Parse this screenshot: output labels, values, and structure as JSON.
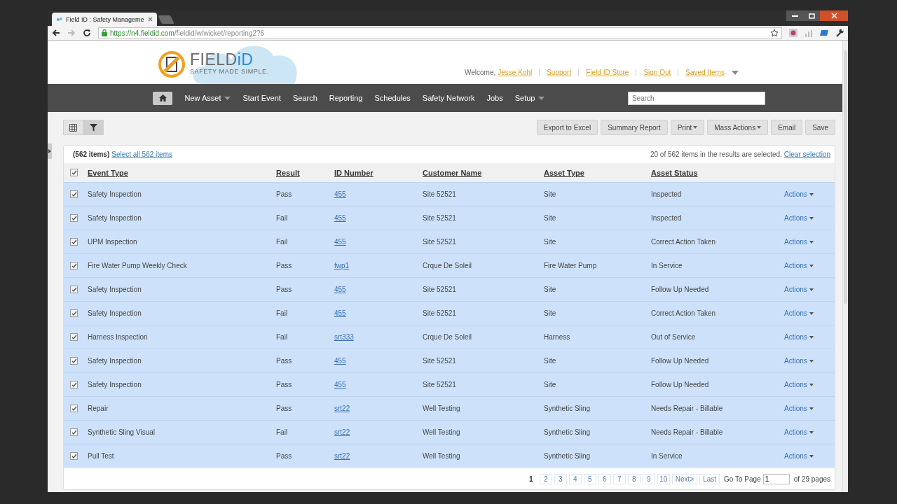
{
  "browser": {
    "tab_title": "Field ID : Safety Manageme",
    "url_host": "https://n4.fieldid.com",
    "url_path": "/fieldid/w/wicket/reporting2?6"
  },
  "logo": {
    "word": "FIELD",
    "accent": "iD",
    "tagline": "SAFETY MADE SIMPLE."
  },
  "user_links": {
    "welcome": "Welcome,",
    "links": [
      "Jesse Kohl",
      "Support",
      "Field ID Store",
      "Sign Out",
      "Saved Items"
    ]
  },
  "nav": {
    "items": [
      {
        "label": "New Asset",
        "has_menu": true
      },
      {
        "label": "Start Event",
        "has_menu": false
      },
      {
        "label": "Search",
        "has_menu": false
      },
      {
        "label": "Reporting",
        "has_menu": false
      },
      {
        "label": "Schedules",
        "has_menu": false
      },
      {
        "label": "Safety Network",
        "has_menu": false
      },
      {
        "label": "Jobs",
        "has_menu": false
      },
      {
        "label": "Setup",
        "has_menu": true
      }
    ],
    "search_placeholder": "Search"
  },
  "view_toggle": [
    {
      "kind": "grid",
      "selected": false
    },
    {
      "kind": "filter",
      "selected": true
    }
  ],
  "toolbar_buttons": [
    {
      "label": "Export to Excel",
      "has_menu": false
    },
    {
      "label": "Summary Report",
      "has_menu": false
    },
    {
      "label": "Print",
      "has_menu": true
    },
    {
      "label": "Mass Actions",
      "has_menu": true
    },
    {
      "label": "Email",
      "has_menu": false
    },
    {
      "label": "Save",
      "has_menu": false
    }
  ],
  "results": {
    "count": "(562 items)",
    "select_all": "Select all 562 items",
    "selection_note": "20 of 562 items in the results are selected.",
    "clear": "Clear selection"
  },
  "table": {
    "all_checked": true,
    "columns": [
      "Event Type",
      "Result",
      "ID Number",
      "Customer Name",
      "Asset Type",
      "Asset Status"
    ],
    "rows": [
      {
        "selected": true,
        "event_type": "Safety Inspection",
        "result": "Pass",
        "id_number": "455",
        "customer": "Site 52521",
        "asset_type": "Site",
        "status": "Inspected",
        "action": "Actions"
      },
      {
        "selected": true,
        "event_type": "Safety Inspection",
        "result": "Fail",
        "id_number": "455",
        "customer": "Site 52521",
        "asset_type": "Site",
        "status": "Inspected",
        "action": "Actions"
      },
      {
        "selected": true,
        "event_type": "UPM Inspection",
        "result": "Fail",
        "id_number": "455",
        "customer": "Site 52521",
        "asset_type": "Site",
        "status": "Correct Action Taken",
        "action": "Actions"
      },
      {
        "selected": true,
        "event_type": "Fire Water Pump Weekly Check",
        "result": "Pass",
        "id_number": "fwp1",
        "customer": "Crque De Soleil",
        "asset_type": "Fire Water Pump",
        "status": "In Service",
        "action": "Actions"
      },
      {
        "selected": true,
        "event_type": "Safety Inspection",
        "result": "Pass",
        "id_number": "455",
        "customer": "Site 52521",
        "asset_type": "Site",
        "status": "Follow Up Needed",
        "action": "Actions"
      },
      {
        "selected": true,
        "event_type": "Safety Inspection",
        "result": "Fail",
        "id_number": "455",
        "customer": "Site 52521",
        "asset_type": "Site",
        "status": "Correct Action Taken",
        "action": "Actions"
      },
      {
        "selected": true,
        "event_type": "Harness Inspection",
        "result": "Fail",
        "id_number": "srt333",
        "customer": "Crque De Soleil",
        "asset_type": "Harness",
        "status": "Out of Service",
        "action": "Actions"
      },
      {
        "selected": true,
        "event_type": "Safety Inspection",
        "result": "Pass",
        "id_number": "455",
        "customer": "Site 52521",
        "asset_type": "Site",
        "status": "Follow Up Needed",
        "action": "Actions"
      },
      {
        "selected": true,
        "event_type": "Safety Inspection",
        "result": "Pass",
        "id_number": "455",
        "customer": "Site 52521",
        "asset_type": "Site",
        "status": "Follow Up Needed",
        "action": "Actions"
      },
      {
        "selected": true,
        "event_type": "Repair",
        "result": "Pass",
        "id_number": "srt22",
        "customer": "Well Testing",
        "asset_type": "Synthetic Sling",
        "status": "Needs Repair - Billable",
        "action": "Actions"
      },
      {
        "selected": true,
        "event_type": "Synthetic Sling Visual",
        "result": "Fail",
        "id_number": "srt22",
        "customer": "Well Testing",
        "asset_type": "Synthetic Sling",
        "status": "Needs Repair - Billable",
        "action": "Actions"
      },
      {
        "selected": true,
        "event_type": "Pull Test",
        "result": "Pass",
        "id_number": "srt22",
        "customer": "Well Testing",
        "asset_type": "Synthetic Sling",
        "status": "In Service",
        "action": "Actions"
      }
    ]
  },
  "pagination": {
    "pages": [
      {
        "label": "1",
        "selected": true
      },
      {
        "label": "2",
        "selected": false
      },
      {
        "label": "3",
        "selected": false
      },
      {
        "label": "4",
        "selected": false
      },
      {
        "label": "5",
        "selected": false
      },
      {
        "label": "6",
        "selected": false
      },
      {
        "label": "7",
        "selected": false
      },
      {
        "label": "8",
        "selected": false
      },
      {
        "label": "9",
        "selected": false
      },
      {
        "label": "10",
        "selected": false
      }
    ],
    "next": "Next>",
    "last": "Last",
    "goto_label": "Go To Page",
    "goto_value": "1",
    "total": "of 29 pages"
  }
}
